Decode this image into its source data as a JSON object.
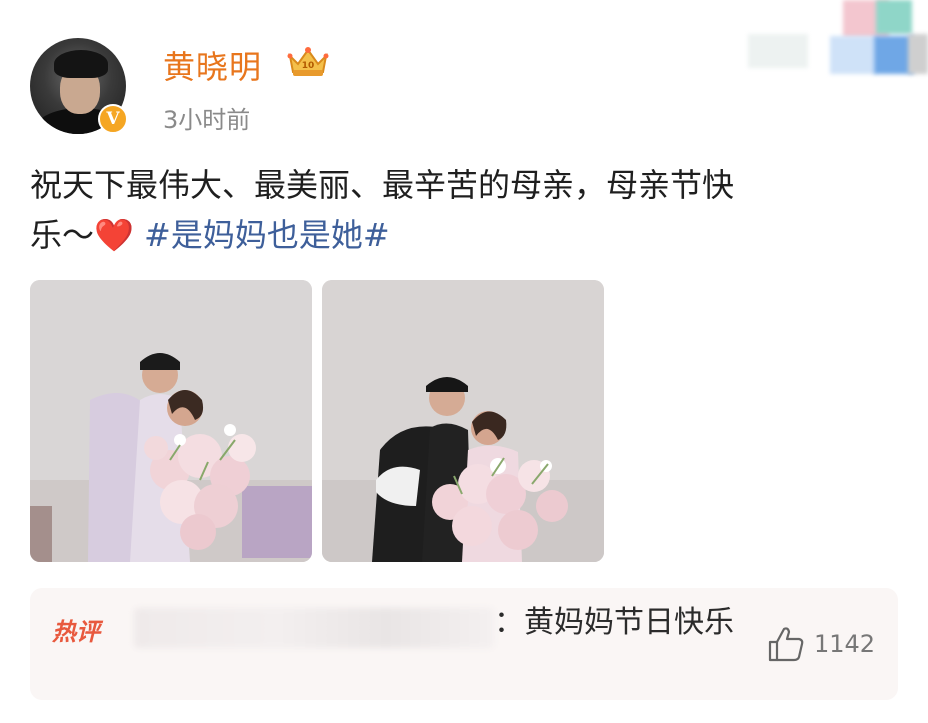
{
  "post": {
    "author": {
      "name": "黄晓明",
      "verified_badge": "V",
      "avatar_icon": "avatar-photo",
      "member_badge_icon": "crown-icon"
    },
    "time": "3小时前",
    "text_line1": "祝天下最伟大、最美丽、最辛苦的母亲，母亲节快",
    "text_line2_prefix": "乐～",
    "heart": "❤️",
    "hashtag": "#是妈妈也是她#",
    "images": [
      {
        "icon": "photo-man-mother-flowers-1"
      },
      {
        "icon": "photo-man-mother-flowers-2"
      }
    ]
  },
  "hot_comment": {
    "tag": "热评",
    "text": "：黄妈妈节日快乐",
    "like_icon": "thumbs-up-icon",
    "like_count": "1142"
  },
  "colors": {
    "username": "#e8761d",
    "hashtag": "#3e5f9a",
    "hot_tag": "#e8593e",
    "heart": "#e2322d",
    "verified": "#f5a623"
  }
}
